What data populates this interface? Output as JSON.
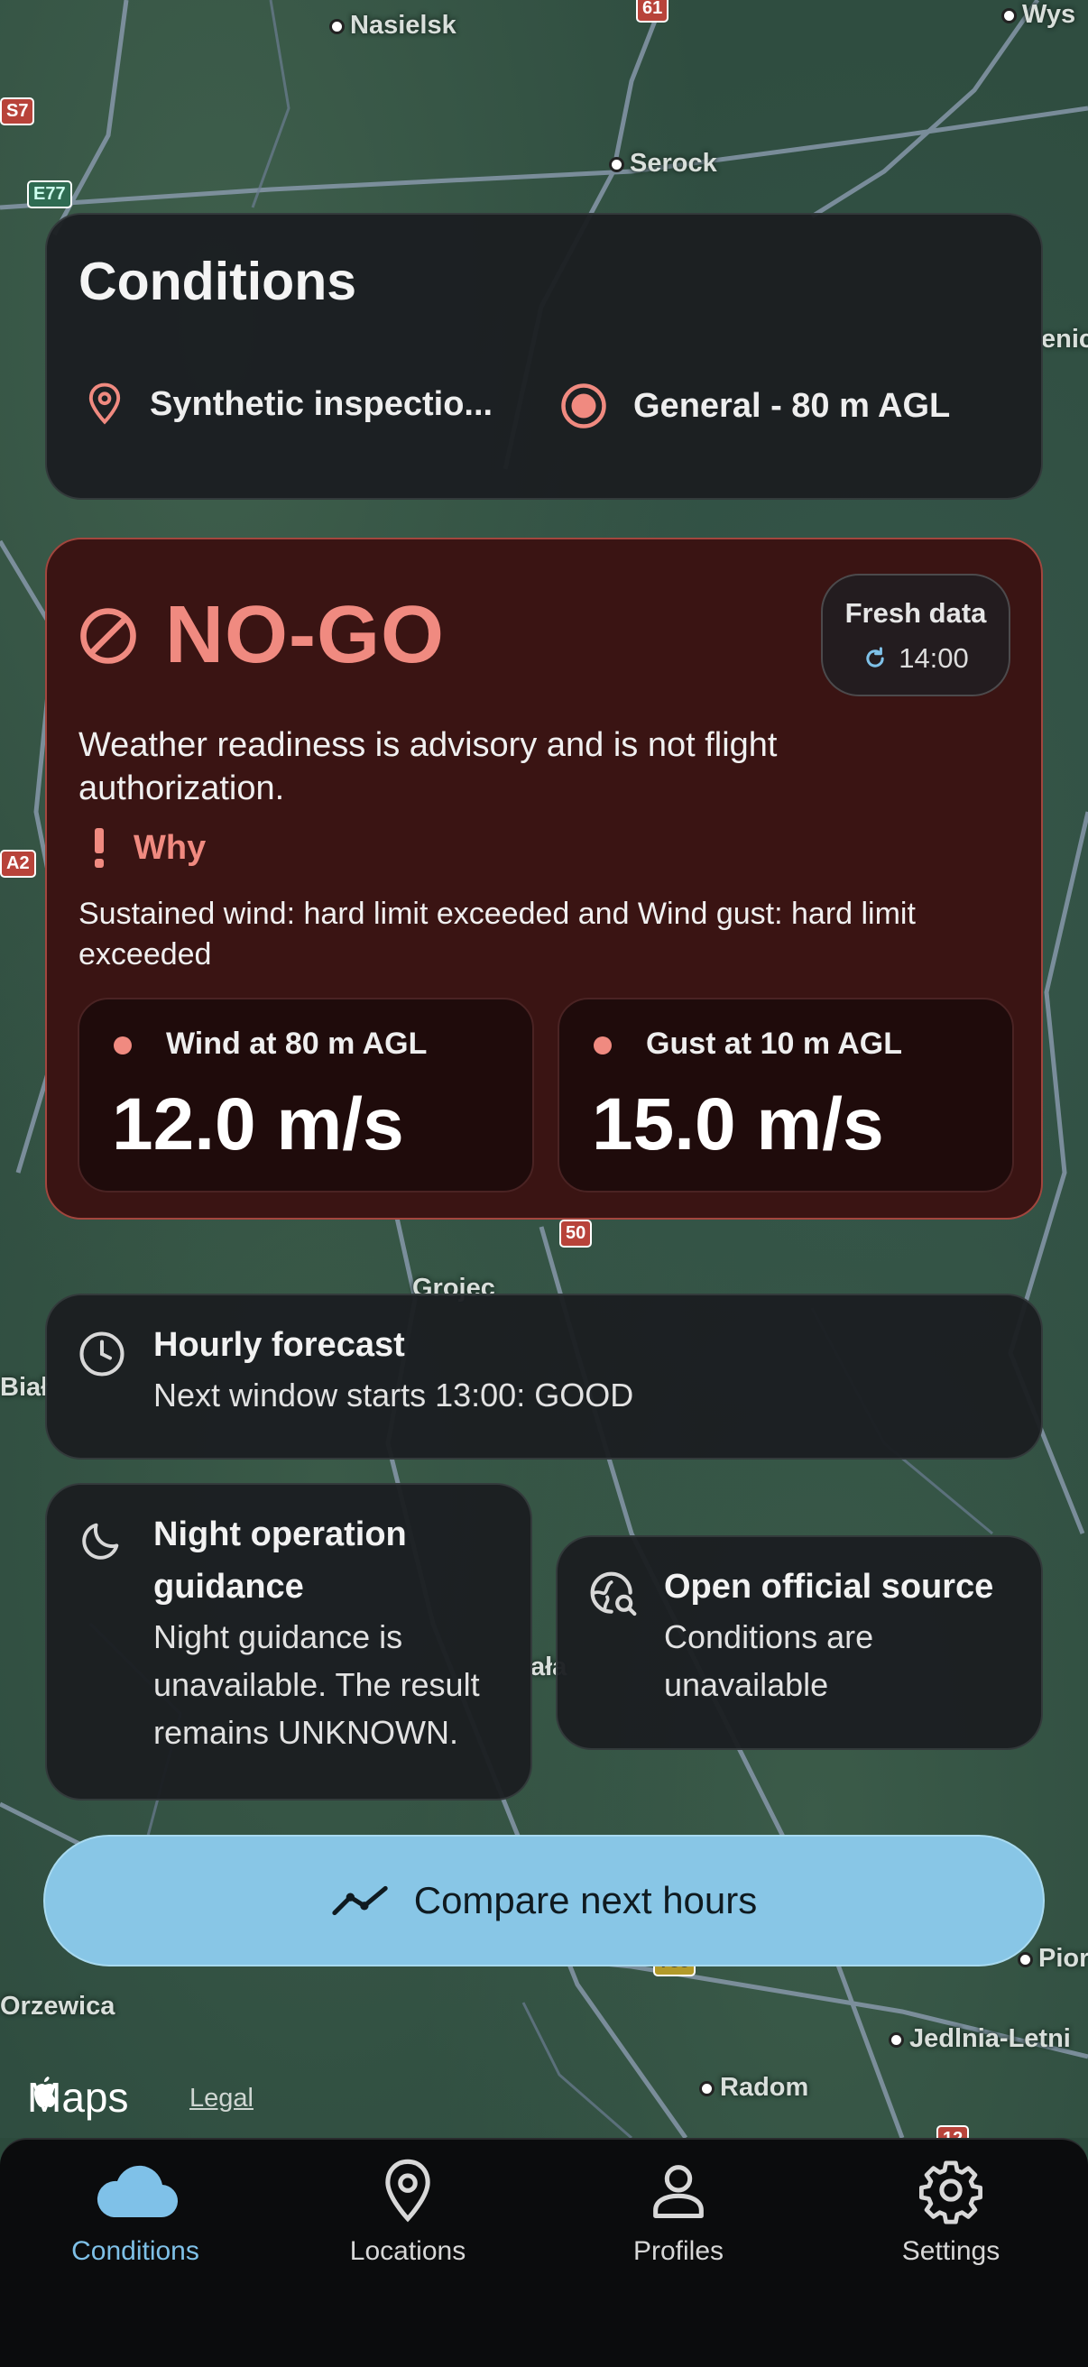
{
  "map": {
    "places": [
      "Nasielsk",
      "Serock",
      "Wys",
      "enic",
      "Grojec",
      "Biał",
      "Radom",
      "Jedlnia-Letni",
      "Pior",
      "Orzewica",
      "ała"
    ],
    "shields": [
      "61",
      "S7",
      "E77",
      "A2",
      "50",
      "735",
      "12"
    ],
    "brand": "Maps",
    "legal": "Legal"
  },
  "conditions": {
    "title": "Conditions",
    "location": "Synthetic inspectio...",
    "profile": "General - 80 m AGL"
  },
  "verdict": {
    "status": "NO-GO",
    "fresh_label": "Fresh data",
    "fresh_time": "14:00",
    "advisory": "Weather readiness is advisory and is not flight authorization.",
    "why_label": "Why",
    "why_text": "Sustained wind: hard limit exceeded and Wind gust: hard limit exceeded",
    "metrics": [
      {
        "label": "Wind at 80 m AGL",
        "value": "12.0 m/s"
      },
      {
        "label": "Gust at 10 m AGL",
        "value": "15.0 m/s"
      }
    ],
    "accent_color": "#f08a80"
  },
  "hourly": {
    "title": "Hourly forecast",
    "subtitle": "Next window starts 13:00: GOOD"
  },
  "night": {
    "title": "Night operation guidance",
    "subtitle": "Night guidance is unavailable. The result remains UNKNOWN."
  },
  "official": {
    "title": "Open official source",
    "subtitle": "Conditions are unavailable"
  },
  "compare": {
    "label": "Compare next hours"
  },
  "tabs": [
    {
      "label": "Conditions",
      "icon": "cloud-icon",
      "active": true
    },
    {
      "label": "Locations",
      "icon": "location-pin-icon",
      "active": false
    },
    {
      "label": "Profiles",
      "icon": "person-icon",
      "active": false
    },
    {
      "label": "Settings",
      "icon": "gear-icon",
      "active": false
    }
  ]
}
